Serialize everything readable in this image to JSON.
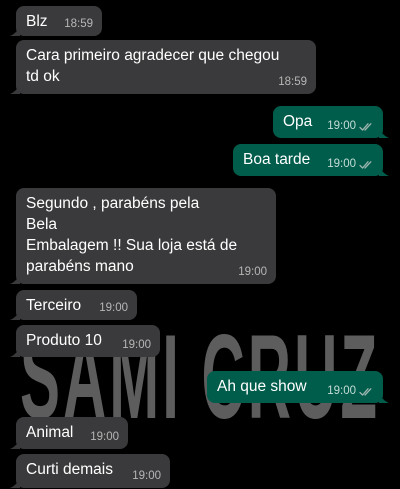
{
  "chat": {
    "wallpaper_text": "SAMI CRUZ",
    "messages": [
      {
        "text": "Blz",
        "time": "18:59"
      },
      {
        "text": "Cara primeiro agradecer que chegou\ntd ok",
        "time": "18:59"
      },
      {
        "text": "Opa",
        "time": "19:00"
      },
      {
        "text": "Boa tarde",
        "time": "19:00"
      },
      {
        "text": "Segundo , parabéns pela\nBela\nEmbalagem !! Sua loja está de\nparabéns mano",
        "time": "19:00"
      },
      {
        "text": "Terceiro",
        "time": "19:00"
      },
      {
        "text": "Produto 10",
        "time": "19:00"
      },
      {
        "text": "Ah que show",
        "time": "19:00"
      },
      {
        "text": "Animal",
        "time": "19:00"
      },
      {
        "text": "Curti demais",
        "time": "19:00"
      }
    ]
  },
  "colors": {
    "background": "#000000",
    "incoming_bubble": "#3a3a3c",
    "outgoing_bubble": "#005c4b",
    "read_ticks": "#9fb7b0"
  },
  "icons": {
    "read_receipt": "double-check-icon"
  }
}
